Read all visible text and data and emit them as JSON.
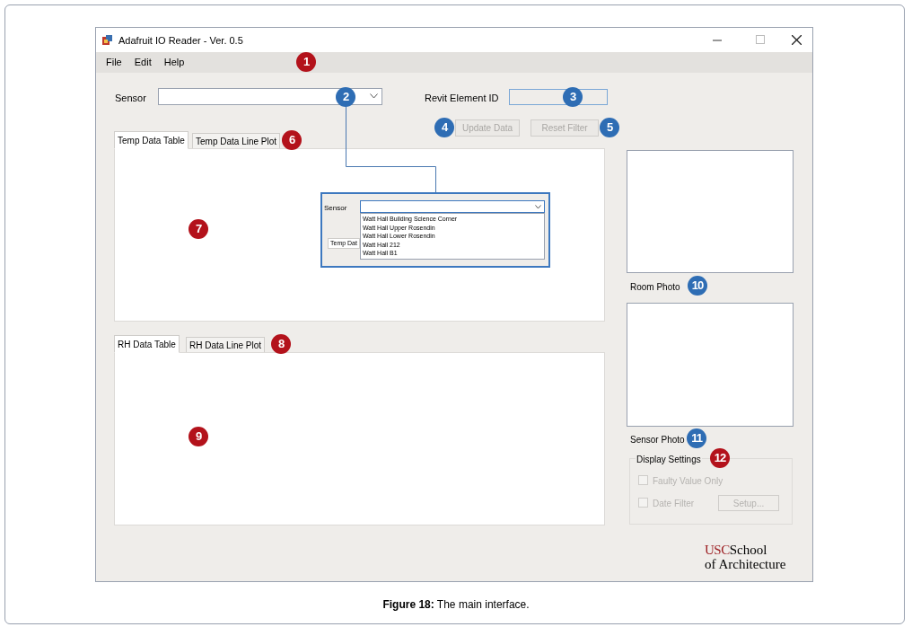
{
  "window": {
    "title": "Adafruit IO Reader - Ver. 0.5"
  },
  "menu": [
    "File",
    "Edit",
    "Help"
  ],
  "sensor": {
    "label": "Sensor"
  },
  "revit": {
    "label": "Revit Element ID",
    "disabled": true
  },
  "buttons": [
    {
      "label": "Update Data",
      "disabled": true
    },
    {
      "label": "Reset Filter",
      "disabled": true
    }
  ],
  "temp_tabs": [
    {
      "label": "Temp Data Table",
      "selected": true
    },
    {
      "label": "Temp Data Line Plot",
      "selected": false
    }
  ],
  "rh_tabs": [
    {
      "label": "RH Data Table",
      "selected": true
    },
    {
      "label": "RH Data Line Plot",
      "selected": false
    }
  ],
  "inset": {
    "label": "Sensor",
    "tab": "Temp Dat",
    "options": [
      "Watt Hall Building Science Corner",
      "Watt Hall Upper Rosendin",
      "Watt Hall Lower Rosendin",
      "Watt Hall 212",
      "Watt Hall B1"
    ]
  },
  "photos": [
    {
      "label": "Room Photo"
    },
    {
      "label": "Sensor Photo"
    }
  ],
  "display_settings": {
    "title": "Display Settings",
    "options": [
      {
        "label": "Faulty Value Only",
        "checked": false,
        "disabled": true
      },
      {
        "label": "Date Filter",
        "checked": false,
        "disabled": true
      }
    ],
    "setup_button": {
      "label": "Setup...",
      "disabled": true
    }
  },
  "logo": {
    "accent": "USC",
    "line1": "School",
    "line2": "of Architecture"
  },
  "markers": [
    {
      "label": "1",
      "color": "#b3121b"
    },
    {
      "label": "2",
      "color": "#2e6db4"
    },
    {
      "label": "3",
      "color": "#2e6db4"
    },
    {
      "label": "4",
      "color": "#2e6db4"
    },
    {
      "label": "5",
      "color": "#2e6db4"
    },
    {
      "label": "6",
      "color": "#b3121b"
    },
    {
      "label": "7",
      "color": "#b3121b"
    },
    {
      "label": "8",
      "color": "#b3121b"
    },
    {
      "label": "9",
      "color": "#b3121b"
    },
    {
      "label": "10",
      "color": "#2e6db4"
    },
    {
      "label": "11",
      "color": "#2e6db4"
    },
    {
      "label": "12",
      "color": "#b3121b"
    }
  ],
  "caption": "**Figure 18:** The main interface."
}
